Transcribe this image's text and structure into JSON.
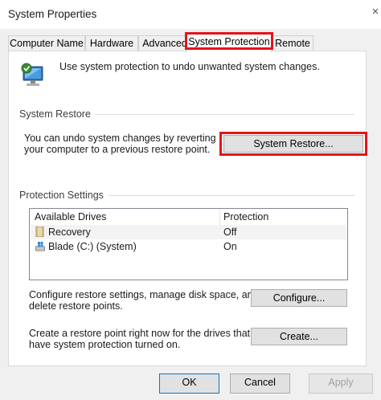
{
  "window": {
    "title": "System Properties",
    "close_glyph": "×"
  },
  "tabs": [
    {
      "label": "Computer Name",
      "active": false
    },
    {
      "label": "Hardware",
      "active": false
    },
    {
      "label": "Advanced",
      "active": false
    },
    {
      "label": "System Protection",
      "active": true
    },
    {
      "label": "Remote",
      "active": false
    }
  ],
  "intro_text": "Use system protection to undo unwanted system changes.",
  "system_restore": {
    "group_label": "System Restore",
    "description_line1": "You can undo system changes by reverting",
    "description_line2": "your computer to a previous restore point.",
    "button_label": "System Restore..."
  },
  "protection_settings": {
    "group_label": "Protection Settings",
    "columns": [
      "Available Drives",
      "Protection"
    ],
    "drives": [
      {
        "name": "Recovery",
        "protection": "Off",
        "icon": "drive-folder-icon"
      },
      {
        "name": "Blade (C:) (System)",
        "protection": "On",
        "icon": "system-drive-icon"
      }
    ],
    "configure_line1": "Configure restore settings, manage disk space, and",
    "configure_line2": "delete restore points.",
    "configure_button": "Configure...",
    "create_line1": "Create a restore point right now for the drives that",
    "create_line2": "have system protection turned on.",
    "create_button": "Create..."
  },
  "footer": {
    "ok": "OK",
    "cancel": "Cancel",
    "apply": "Apply"
  },
  "colors": {
    "highlight": "#e3141b",
    "window_bg": "#f0f0f0"
  }
}
